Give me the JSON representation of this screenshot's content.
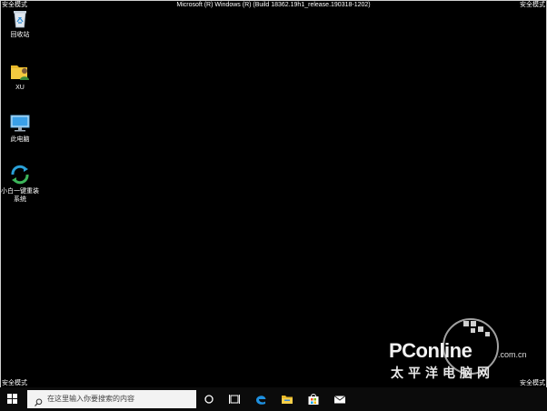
{
  "corner_labels": {
    "top_left": "安全模式",
    "top_right": "安全模式",
    "bottom_left": "安全模式",
    "bottom_right": "安全模式"
  },
  "build_string": "Microsoft (R) Windows (R) (Build 18362.19h1_release.190318-1202)",
  "desktop_icons": [
    {
      "icon": "recycle-bin-icon",
      "label": "回收站"
    },
    {
      "icon": "user-folder-icon",
      "label": "XU"
    },
    {
      "icon": "this-pc-icon",
      "label": "此电脑"
    },
    {
      "icon": "reinstall-tool-icon",
      "label": "小白一键重装系统"
    }
  ],
  "taskbar": {
    "search_placeholder": "在这里输入你要搜索的内容",
    "pinned": [
      "cortana-icon",
      "task-view-icon",
      "edge-icon",
      "file-explorer-icon",
      "store-icon",
      "mail-icon"
    ]
  },
  "watermark": {
    "brand": "PConline",
    "domain": ".com.cn",
    "tagline": "太平洋电脑网"
  },
  "colors": {
    "desktop_background": "#000000",
    "search_box": "#f3f3f3",
    "edge_blue": "#1e90e0",
    "folder_yellow": "#e8b829"
  }
}
